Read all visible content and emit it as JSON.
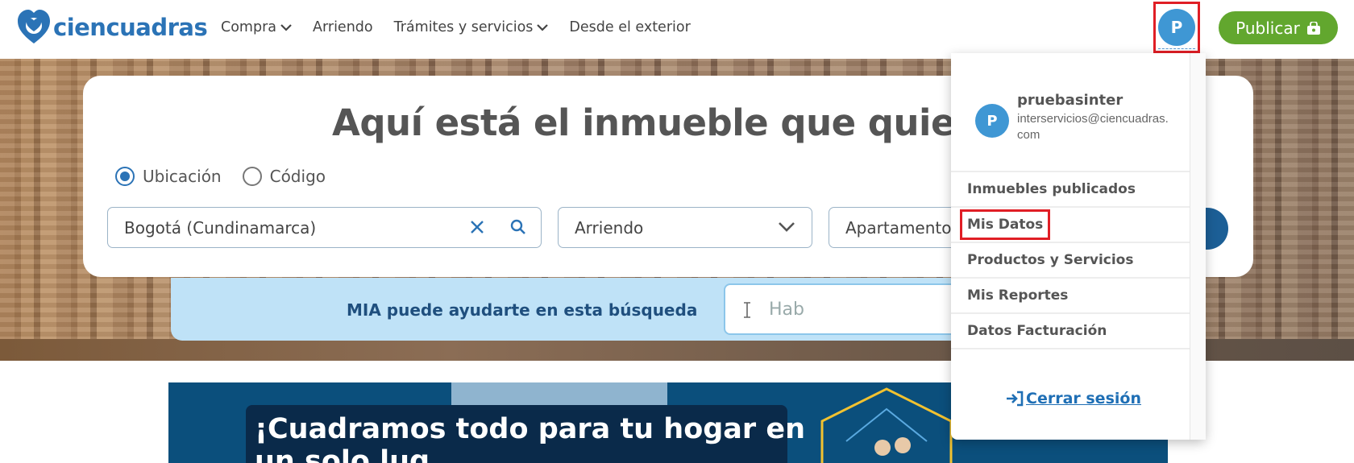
{
  "header": {
    "brand": {
      "part1": "cien",
      "part2": "cuadras"
    },
    "nav": [
      {
        "label": "Compra",
        "has_dropdown": true
      },
      {
        "label": "Arriendo",
        "has_dropdown": false
      },
      {
        "label": "Trámites y servicios",
        "has_dropdown": true
      },
      {
        "label": "Desde el exterior",
        "has_dropdown": false
      }
    ],
    "avatar_initial": "P",
    "publish_label": "Publicar"
  },
  "hero": {
    "title": "Aquí está el inmueble que quier",
    "search_mode": {
      "options": [
        "Ubicación",
        "Código"
      ],
      "selected": "Ubicación"
    },
    "location_value": "Bogotá (Cundinamarca)",
    "operation_value": "Arriendo",
    "property_type_value": "Apartamento",
    "mia_text": "MIA puede ayudarte en esta búsqueda",
    "mia_input_value": "Hab"
  },
  "banner": {
    "title_line1": "¡Cuadramos todo para tu hogar en",
    "title_line2": "un solo lug"
  },
  "user_menu": {
    "avatar_initial": "P",
    "username": "pruebasinter",
    "email": "interservicios@ciencuadras.com",
    "items": [
      "Inmuebles publicados",
      "Mis Datos",
      "Productos y Servicios",
      "Mis Reportes",
      "Datos Facturación"
    ],
    "highlighted_item": "Mis Datos",
    "logout_label": "Cerrar sesión"
  },
  "colors": {
    "brand_blue": "#2b73b6",
    "publish_green": "#62a72e",
    "avatar_blue": "#3f97d4",
    "highlight_red": "#e01e25",
    "mia_bg": "#bfe2f7"
  },
  "icons": [
    "heart-logo-icon",
    "chevron-down-icon",
    "shopping-bag-icon",
    "close-icon",
    "search-icon",
    "text-cursor-icon",
    "sign-in-icon"
  ]
}
